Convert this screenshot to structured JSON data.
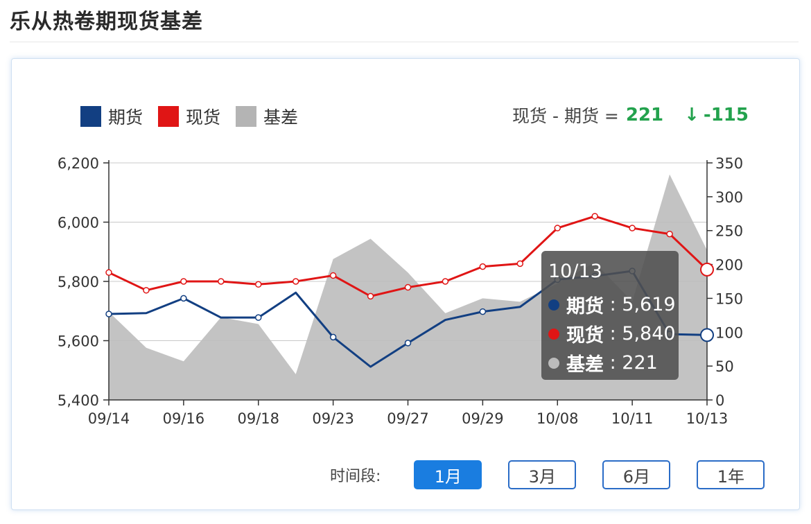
{
  "page": {
    "title": "乐从热卷期现货基差"
  },
  "legend": [
    {
      "label": "期货",
      "color": "#123f82"
    },
    {
      "label": "现货",
      "color": "#e01515"
    },
    {
      "label": "基差",
      "color": "#b4b4b4"
    }
  ],
  "summary": {
    "formula": "现货 - 期货 =",
    "value": "221",
    "arrow": "↓",
    "change": "-115"
  },
  "chart_data": {
    "type": "line",
    "categories": [
      "09/14",
      "09/15",
      "09/16",
      "09/17",
      "09/18",
      "09/21",
      "09/23",
      "09/24",
      "09/27",
      "09/28",
      "09/29",
      "09/30",
      "10/08",
      "10/09",
      "10/11",
      "10/12",
      "10/13"
    ],
    "x_tick_labels": [
      "09/14",
      "09/16",
      "09/18",
      "09/23",
      "09/27",
      "09/29",
      "10/08",
      "10/11",
      "10/13"
    ],
    "y_left": {
      "min": 5400,
      "max": 6200,
      "ticks": [
        "5,400",
        "5,600",
        "5,800",
        "6,000",
        "6,200"
      ]
    },
    "y_right": {
      "min": 0,
      "max": 350,
      "ticks": [
        "0",
        "50",
        "100",
        "150",
        "200",
        "250",
        "300",
        "350"
      ]
    },
    "grid": true,
    "series": [
      {
        "name": "期货",
        "axis": "left",
        "color": "#123f82",
        "values": [
          5690,
          5693,
          5743,
          5678,
          5678,
          5762,
          5612,
          5512,
          5592,
          5670,
          5698,
          5714,
          5806,
          5818,
          5835,
          5622,
          5619
        ]
      },
      {
        "name": "现货",
        "axis": "left",
        "color": "#e01515",
        "values": [
          5830,
          5770,
          5800,
          5800,
          5790,
          5800,
          5820,
          5750,
          5780,
          5800,
          5850,
          5860,
          5980,
          6020,
          5980,
          5960,
          5840
        ]
      },
      {
        "name": "基差",
        "axis": "right",
        "type": "area",
        "color": "#b4b4b4",
        "values": [
          130,
          77,
          57,
          122,
          112,
          38,
          208,
          238,
          188,
          128,
          150,
          145,
          172,
          203,
          145,
          333,
          221
        ]
      }
    ],
    "tooltip": {
      "date": "10/13",
      "rows": [
        {
          "name": "期货",
          "value": "5,619",
          "color": "#123f82"
        },
        {
          "name": "现货",
          "value": "5,840",
          "color": "#e01515"
        },
        {
          "name": "基差",
          "value": "221",
          "color": "#bbbbbb"
        }
      ]
    }
  },
  "period": {
    "label": "时间段:",
    "buttons": [
      {
        "label": "1月",
        "active": true
      },
      {
        "label": "3月",
        "active": false
      },
      {
        "label": "6月",
        "active": false
      },
      {
        "label": "1年",
        "active": false
      }
    ]
  }
}
